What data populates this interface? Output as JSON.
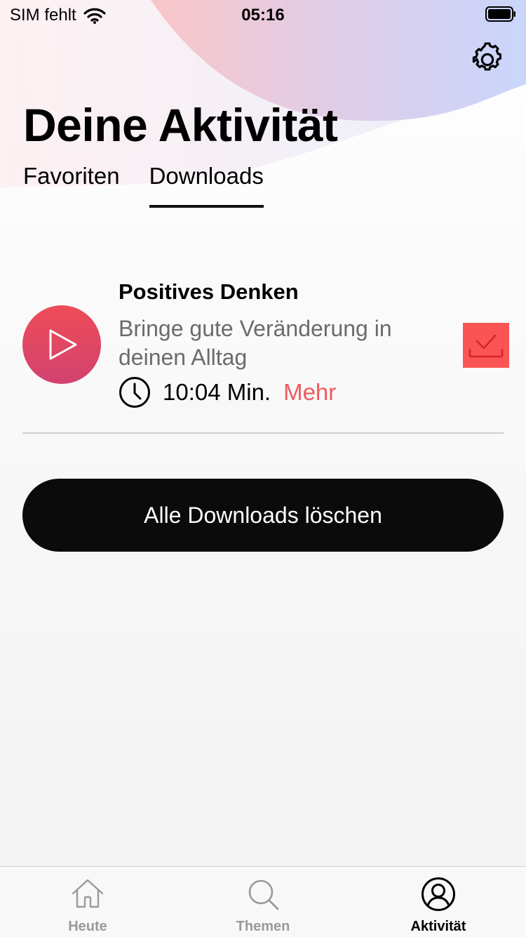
{
  "status_bar": {
    "carrier": "SIM fehlt",
    "time": "05:16"
  },
  "header": {
    "title": "Deine Aktivität"
  },
  "tabs": [
    {
      "label": "Favoriten",
      "active": false
    },
    {
      "label": "Downloads",
      "active": true
    }
  ],
  "downloads": [
    {
      "title": "Positives Denken",
      "description": "Bringe gute Veränderung in deinen Alltag",
      "duration": "10:04 Min.",
      "more_label": "Mehr",
      "icon": "play-icon",
      "downloaded": true
    }
  ],
  "delete_all_label": "Alle Downloads löschen",
  "tab_bar": {
    "items": [
      {
        "label": "Heute",
        "icon": "home-icon",
        "active": false
      },
      {
        "label": "Themen",
        "icon": "search-icon",
        "active": false
      },
      {
        "label": "Aktivität",
        "icon": "profile-icon",
        "active": true
      }
    ]
  },
  "colors": {
    "accent": "#f05a5f",
    "download_box": "#fb5454",
    "play_gradient_top": "#ef4c58",
    "play_gradient_bottom": "#d2426f",
    "button_bg": "#0b0b0b"
  }
}
